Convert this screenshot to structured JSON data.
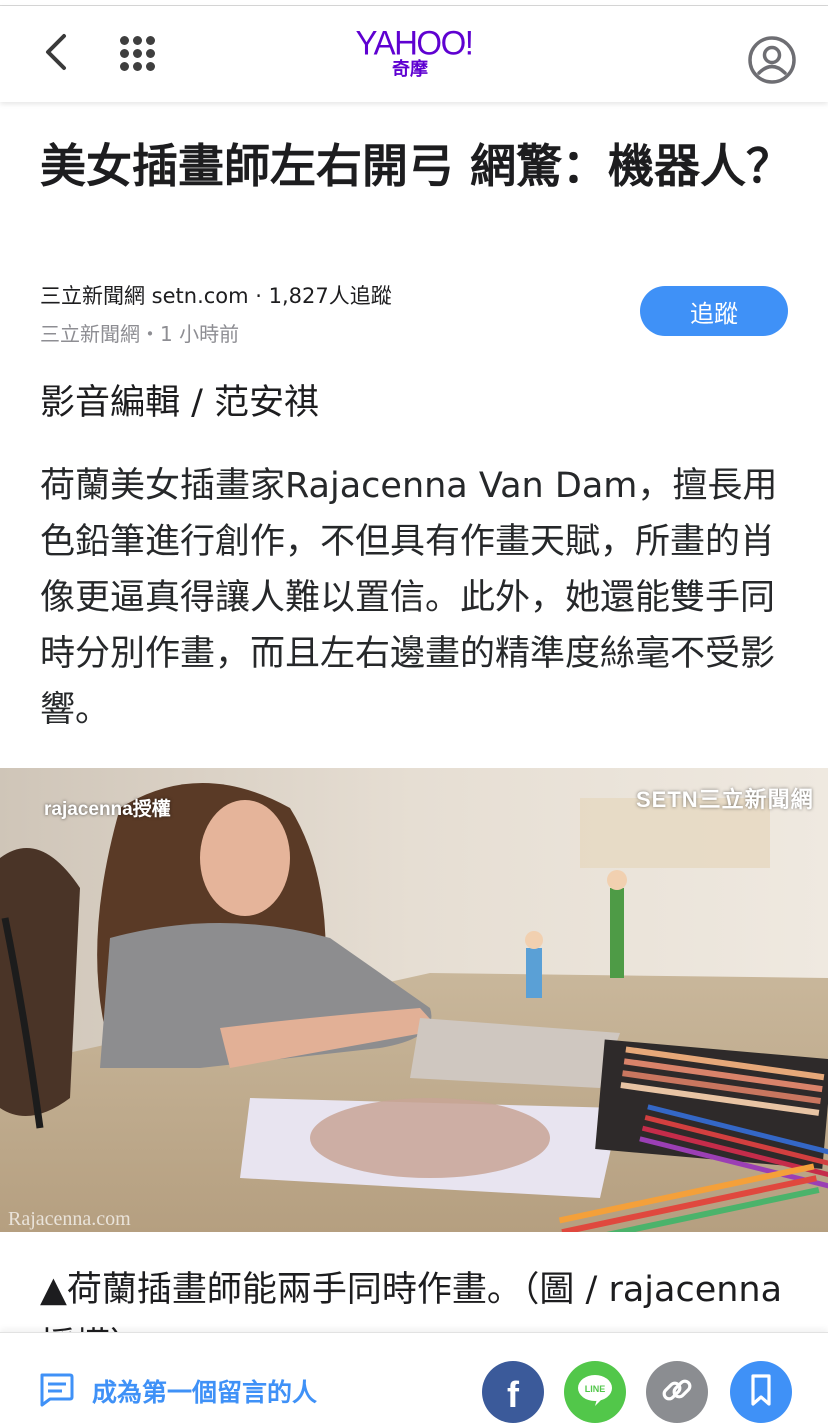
{
  "header": {
    "logo_text": "YAHOO!",
    "logo_sub": "奇摩",
    "icons": [
      "back-icon",
      "apps-grid-icon",
      "profile-icon"
    ],
    "brand_color": "#5f01d1"
  },
  "article": {
    "title": "美女插畫師左右開弓 網驚：機器人？",
    "source_line": "三立新聞網 setn.com · 1,827人追蹤",
    "meta_line": "三立新聞網・1 小時前",
    "follow_label": "追蹤",
    "editor": "影音編輯 / 范安祺",
    "body": "荷蘭美女插畫家Rajacenna Van Dam，擅長用色鉛筆進行創作，不但具有作畫天賦，所畫的肖像更逼真得讓人難以置信。此外，她還能雙手同時分別作畫，而且左右邊畫的精準度絲毫不受影響。",
    "photo": {
      "watermark_left": "rajacenna授權",
      "watermark_right": "SETN三立新聞網",
      "watermark_bottom": "Rajacenna.com"
    },
    "caption": "▲荷蘭插畫師能兩手同時作畫。（圖 / rajacenna授權）"
  },
  "bottom_bar": {
    "comment_label": "成為第一個留言的人",
    "share_icons": [
      "facebook-icon",
      "line-icon",
      "link-icon",
      "bookmark-icon"
    ],
    "accent_color": "#3f91f7"
  }
}
